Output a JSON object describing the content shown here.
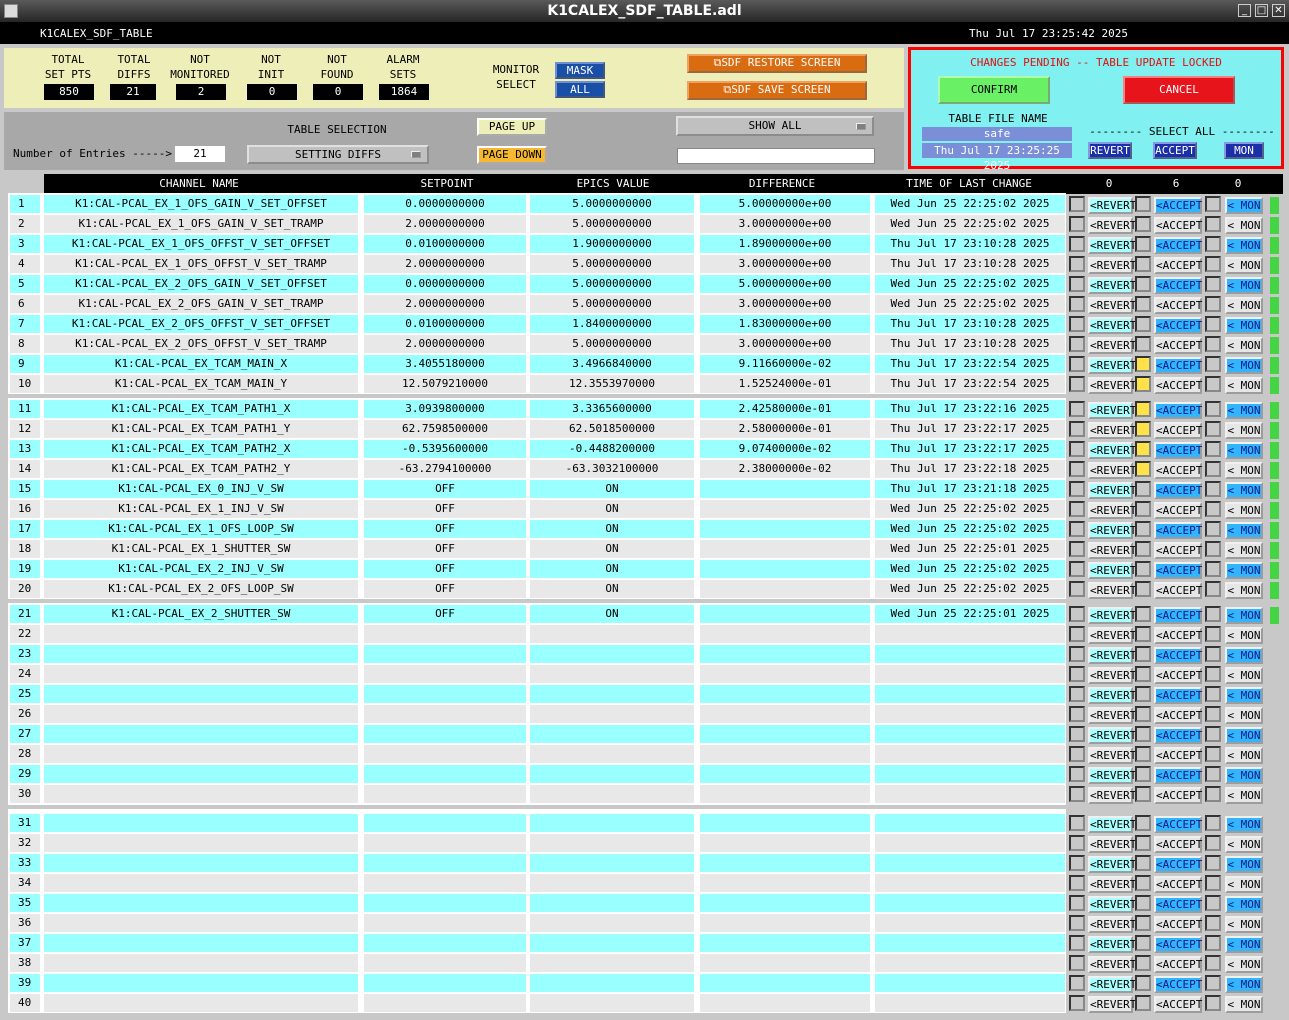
{
  "window": {
    "title": "K1CALEX_SDF_TABLE.adl",
    "controls": [
      "_",
      "□",
      "✕"
    ]
  },
  "header": {
    "name": "K1CALEX_SDF_TABLE",
    "datetime": "Thu Jul 17 23:25:42 2025"
  },
  "stats": [
    {
      "label1": "TOTAL",
      "label2": "SET PTS",
      "value": "850"
    },
    {
      "label1": "TOTAL",
      "label2": "DIFFS",
      "value": "21"
    },
    {
      "label1": "NOT",
      "label2": "MONITORED",
      "value": "2"
    },
    {
      "label1": "NOT",
      "label2": "INIT",
      "value": "0"
    },
    {
      "label1": "NOT",
      "label2": "FOUND",
      "value": "0"
    },
    {
      "label1": "ALARM",
      "label2": "SETS",
      "value": "1864"
    }
  ],
  "monitor": {
    "label1": "MONITOR",
    "label2": "SELECT",
    "mask": "MASK",
    "all": "ALL"
  },
  "sdf_buttons": {
    "restore": "SDF RESTORE SCREEN",
    "save": "SDF SAVE SCREEN"
  },
  "lock_panel": {
    "status": "CHANGES PENDING -- TABLE UPDATE LOCKED",
    "confirm": "CONFIRM",
    "cancel": "CANCEL",
    "table_file_label": "TABLE FILE NAME",
    "table_file_name": "safe",
    "table_file_date": "Thu Jul 17 23:25:25 2025",
    "select_all": "-------- SELECT ALL --------",
    "revert": "REVERT",
    "accept": "ACCEPT",
    "mon": "MON"
  },
  "controls": {
    "entries_label": "Number of Entries ----->",
    "entries_value": "21",
    "table_selection_label": "TABLE SELECTION",
    "table_selection_value": "SETTING DIFFS",
    "page_up": "PAGE UP",
    "page_down": "PAGE DOWN",
    "show_all": "SHOW ALL",
    "filter_value": ""
  },
  "table": {
    "headers": {
      "channel": "CHANNEL NAME",
      "setpoint": "SETPOINT",
      "epics": "EPICS VALUE",
      "difference": "DIFFERENCE",
      "time": "TIME OF LAST CHANGE",
      "count_revert": "0",
      "count_accept": "6",
      "count_mon": "0"
    },
    "button_labels": {
      "revert": "<REVERT",
      "accept": "<ACCEPT",
      "mon": "< MON"
    },
    "rows": [
      {
        "num": "1",
        "channel": "K1:CAL-PCAL_EX_1_OFS_GAIN_V_SET_OFFSET",
        "setpoint": "0.0000000000",
        "epics": "5.0000000000",
        "difference": "5.00000000e+00",
        "time": "Wed Jun 25 22:25:02 2025",
        "accept": false,
        "active": true
      },
      {
        "num": "2",
        "channel": "K1:CAL-PCAL_EX_1_OFS_GAIN_V_SET_TRAMP",
        "setpoint": "2.0000000000",
        "epics": "5.0000000000",
        "difference": "3.00000000e+00",
        "time": "Wed Jun 25 22:25:02 2025",
        "accept": false,
        "active": true
      },
      {
        "num": "3",
        "channel": "K1:CAL-PCAL_EX_1_OFS_OFFST_V_SET_OFFSET",
        "setpoint": "0.0100000000",
        "epics": "1.9000000000",
        "difference": "1.89000000e+00",
        "time": "Thu Jul 17 23:10:28 2025",
        "accept": false,
        "active": true
      },
      {
        "num": "4",
        "channel": "K1:CAL-PCAL_EX_1_OFS_OFFST_V_SET_TRAMP",
        "setpoint": "2.0000000000",
        "epics": "5.0000000000",
        "difference": "3.00000000e+00",
        "time": "Thu Jul 17 23:10:28 2025",
        "accept": false,
        "active": true
      },
      {
        "num": "5",
        "channel": "K1:CAL-PCAL_EX_2_OFS_GAIN_V_SET_OFFSET",
        "setpoint": "0.0000000000",
        "epics": "5.0000000000",
        "difference": "5.00000000e+00",
        "time": "Wed Jun 25 22:25:02 2025",
        "accept": false,
        "active": true
      },
      {
        "num": "6",
        "channel": "K1:CAL-PCAL_EX_2_OFS_GAIN_V_SET_TRAMP",
        "setpoint": "2.0000000000",
        "epics": "5.0000000000",
        "difference": "3.00000000e+00",
        "time": "Wed Jun 25 22:25:02 2025",
        "accept": false,
        "active": true
      },
      {
        "num": "7",
        "channel": "K1:CAL-PCAL_EX_2_OFS_OFFST_V_SET_OFFSET",
        "setpoint": "0.0100000000",
        "epics": "1.8400000000",
        "difference": "1.83000000e+00",
        "time": "Thu Jul 17 23:10:28 2025",
        "accept": false,
        "active": true
      },
      {
        "num": "8",
        "channel": "K1:CAL-PCAL_EX_2_OFS_OFFST_V_SET_TRAMP",
        "setpoint": "2.0000000000",
        "epics": "5.0000000000",
        "difference": "3.00000000e+00",
        "time": "Thu Jul 17 23:10:28 2025",
        "accept": false,
        "active": true
      },
      {
        "num": "9",
        "channel": "K1:CAL-PCAL_EX_TCAM_MAIN_X",
        "setpoint": "3.4055180000",
        "epics": "3.4966840000",
        "difference": "9.11660000e-02",
        "time": "Thu Jul 17 23:22:54 2025",
        "accept": true,
        "active": true
      },
      {
        "num": "10",
        "channel": "K1:CAL-PCAL_EX_TCAM_MAIN_Y",
        "setpoint": "12.5079210000",
        "epics": "12.3553970000",
        "difference": "1.52524000e-01",
        "time": "Thu Jul 17 23:22:54 2025",
        "accept": true,
        "active": true
      },
      {
        "num": "11",
        "channel": "K1:CAL-PCAL_EX_TCAM_PATH1_X",
        "setpoint": "3.0939800000",
        "epics": "3.3365600000",
        "difference": "2.42580000e-01",
        "time": "Thu Jul 17 23:22:16 2025",
        "accept": true,
        "active": true
      },
      {
        "num": "12",
        "channel": "K1:CAL-PCAL_EX_TCAM_PATH1_Y",
        "setpoint": "62.7598500000",
        "epics": "62.5018500000",
        "difference": "2.58000000e-01",
        "time": "Thu Jul 17 23:22:17 2025",
        "accept": true,
        "active": true
      },
      {
        "num": "13",
        "channel": "K1:CAL-PCAL_EX_TCAM_PATH2_X",
        "setpoint": "-0.5395600000",
        "epics": "-0.4488200000",
        "difference": "9.07400000e-02",
        "time": "Thu Jul 17 23:22:17 2025",
        "accept": true,
        "active": true
      },
      {
        "num": "14",
        "channel": "K1:CAL-PCAL_EX_TCAM_PATH2_Y",
        "setpoint": "-63.2794100000",
        "epics": "-63.3032100000",
        "difference": "2.38000000e-02",
        "time": "Thu Jul 17 23:22:18 2025",
        "accept": true,
        "active": true
      },
      {
        "num": "15",
        "channel": "K1:CAL-PCAL_EX_0_INJ_V_SW",
        "setpoint": "OFF",
        "epics": "ON",
        "difference": "",
        "time": "Thu Jul 17 23:21:18 2025",
        "accept": false,
        "active": true
      },
      {
        "num": "16",
        "channel": "K1:CAL-PCAL_EX_1_INJ_V_SW",
        "setpoint": "OFF",
        "epics": "ON",
        "difference": "",
        "time": "Wed Jun 25 22:25:02 2025",
        "accept": false,
        "active": true
      },
      {
        "num": "17",
        "channel": "K1:CAL-PCAL_EX_1_OFS_LOOP_SW",
        "setpoint": "OFF",
        "epics": "ON",
        "difference": "",
        "time": "Wed Jun 25 22:25:02 2025",
        "accept": false,
        "active": true
      },
      {
        "num": "18",
        "channel": "K1:CAL-PCAL_EX_1_SHUTTER_SW",
        "setpoint": "OFF",
        "epics": "ON",
        "difference": "",
        "time": "Wed Jun 25 22:25:01 2025",
        "accept": false,
        "active": true
      },
      {
        "num": "19",
        "channel": "K1:CAL-PCAL_EX_2_INJ_V_SW",
        "setpoint": "OFF",
        "epics": "ON",
        "difference": "",
        "time": "Wed Jun 25 22:25:02 2025",
        "accept": false,
        "active": true
      },
      {
        "num": "20",
        "channel": "K1:CAL-PCAL_EX_2_OFS_LOOP_SW",
        "setpoint": "OFF",
        "epics": "ON",
        "difference": "",
        "time": "Wed Jun 25 22:25:02 2025",
        "accept": false,
        "active": true
      },
      {
        "num": "21",
        "channel": "K1:CAL-PCAL_EX_2_SHUTTER_SW",
        "setpoint": "OFF",
        "epics": "ON",
        "difference": "",
        "time": "Wed Jun 25 22:25:01 2025",
        "accept": false,
        "active": true
      },
      {
        "num": "22",
        "channel": "",
        "setpoint": "",
        "epics": "",
        "difference": "",
        "time": "",
        "accept": false,
        "active": false
      },
      {
        "num": "23",
        "channel": "",
        "setpoint": "",
        "epics": "",
        "difference": "",
        "time": "",
        "accept": false,
        "active": false
      },
      {
        "num": "24",
        "channel": "",
        "setpoint": "",
        "epics": "",
        "difference": "",
        "time": "",
        "accept": false,
        "active": false
      },
      {
        "num": "25",
        "channel": "",
        "setpoint": "",
        "epics": "",
        "difference": "",
        "time": "",
        "accept": false,
        "active": false
      },
      {
        "num": "26",
        "channel": "",
        "setpoint": "",
        "epics": "",
        "difference": "",
        "time": "",
        "accept": false,
        "active": false
      },
      {
        "num": "27",
        "channel": "",
        "setpoint": "",
        "epics": "",
        "difference": "",
        "time": "",
        "accept": false,
        "active": false
      },
      {
        "num": "28",
        "channel": "",
        "setpoint": "",
        "epics": "",
        "difference": "",
        "time": "",
        "accept": false,
        "active": false
      },
      {
        "num": "29",
        "channel": "",
        "setpoint": "",
        "epics": "",
        "difference": "",
        "time": "",
        "accept": false,
        "active": false
      },
      {
        "num": "30",
        "channel": "",
        "setpoint": "",
        "epics": "",
        "difference": "",
        "time": "",
        "accept": false,
        "active": false
      },
      {
        "num": "31",
        "channel": "",
        "setpoint": "",
        "epics": "",
        "difference": "",
        "time": "",
        "accept": false,
        "active": false
      },
      {
        "num": "32",
        "channel": "",
        "setpoint": "",
        "epics": "",
        "difference": "",
        "time": "",
        "accept": false,
        "active": false
      },
      {
        "num": "33",
        "channel": "",
        "setpoint": "",
        "epics": "",
        "difference": "",
        "time": "",
        "accept": false,
        "active": false
      },
      {
        "num": "34",
        "channel": "",
        "setpoint": "",
        "epics": "",
        "difference": "",
        "time": "",
        "accept": false,
        "active": false
      },
      {
        "num": "35",
        "channel": "",
        "setpoint": "",
        "epics": "",
        "difference": "",
        "time": "",
        "accept": false,
        "active": false
      },
      {
        "num": "36",
        "channel": "",
        "setpoint": "",
        "epics": "",
        "difference": "",
        "time": "",
        "accept": false,
        "active": false
      },
      {
        "num": "37",
        "channel": "",
        "setpoint": "",
        "epics": "",
        "difference": "",
        "time": "",
        "accept": false,
        "active": false
      },
      {
        "num": "38",
        "channel": "",
        "setpoint": "",
        "epics": "",
        "difference": "",
        "time": "",
        "accept": false,
        "active": false
      },
      {
        "num": "39",
        "channel": "",
        "setpoint": "",
        "epics": "",
        "difference": "",
        "time": "",
        "accept": false,
        "active": false
      },
      {
        "num": "40",
        "channel": "",
        "setpoint": "",
        "epics": "",
        "difference": "",
        "time": "",
        "accept": false,
        "active": false
      }
    ]
  },
  "colors": {
    "cyan": "#99ffff",
    "lightgray": "#e8e8e8",
    "accept_blue": "#2b4fd8",
    "yellow": "#ffe14a",
    "green": "#44d444",
    "confirm_green": "#6af064",
    "cancel_red": "#e8141c"
  }
}
